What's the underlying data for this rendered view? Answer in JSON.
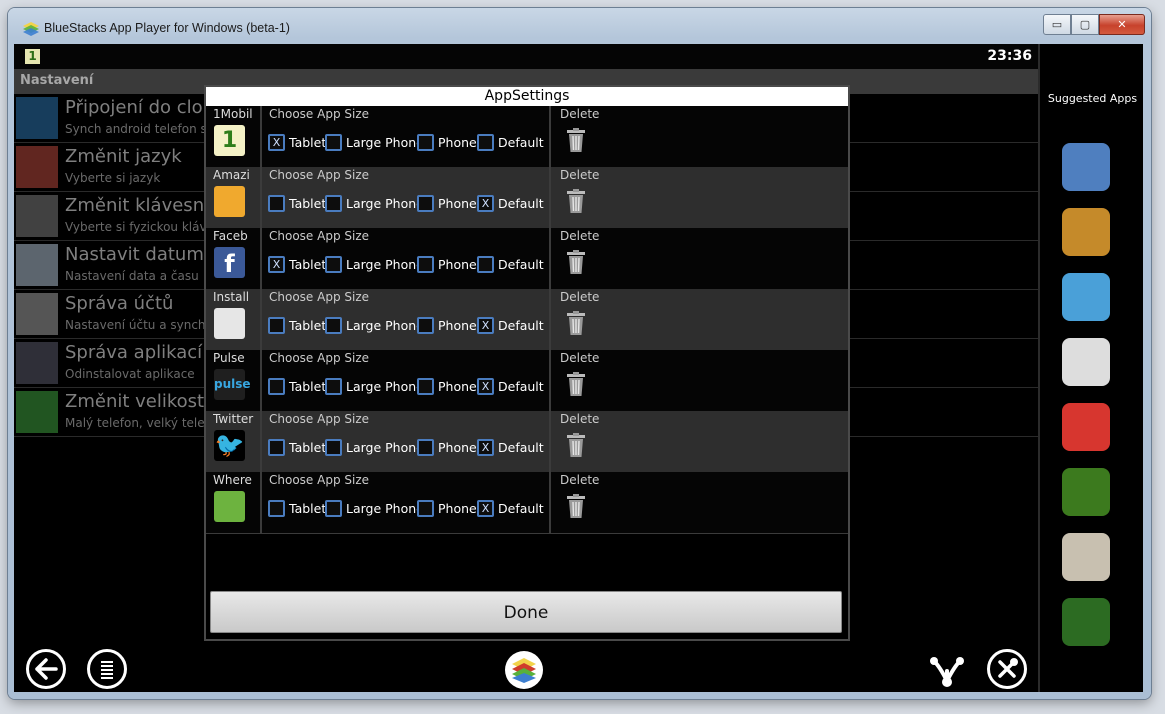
{
  "window": {
    "title": "BlueStacks App Player for Windows (beta-1)",
    "buttons": {
      "minimize": "▭",
      "maximize": "▢",
      "close": "✕"
    }
  },
  "statusbar": {
    "notification_icon": "1",
    "time": "23:36"
  },
  "settings": {
    "header": "Nastavení",
    "rows": [
      {
        "title": "Připojení do cloudu",
        "subtitle": "Synch android telefon s PC",
        "icon": "cloud-phone-icon"
      },
      {
        "title": "Změnit jazyk",
        "subtitle": "Vyberte si jazyk",
        "icon": "flags-icon"
      },
      {
        "title": "Změnit klávesnici",
        "subtitle": "Vyberte si fyzickou klávesnici",
        "icon": "keyboard-icon"
      },
      {
        "title": "Nastavit datum a čas",
        "subtitle": "Nastavení data a času",
        "icon": "calendar-icon"
      },
      {
        "title": "Správa účtů",
        "subtitle": "Nastavení účtu a synchronizace",
        "icon": "person-icon"
      },
      {
        "title": "Správa aplikací",
        "subtitle": "Odinstalovat aplikace",
        "icon": "trash-bin-icon"
      },
      {
        "title": "Změnit velikost aplikací",
        "subtitle": "Malý telefon, velký telefon, tablet",
        "icon": "resize-arrow-icon"
      }
    ]
  },
  "dialog": {
    "title": "AppSettings",
    "size_label": "Choose App Size",
    "delete_label": "Delete",
    "options": [
      "Tablet",
      "Large Phone",
      "Phone",
      "Default"
    ],
    "done_label": "Done",
    "apps": [
      {
        "name": "1Mobil",
        "selected": "Tablet",
        "icon": "1mobile-icon"
      },
      {
        "name": "Amazi",
        "selected": "Default",
        "icon": "amazing-alex-icon"
      },
      {
        "name": "Faceb",
        "selected": "Tablet",
        "icon": "facebook-icon"
      },
      {
        "name": "Install",
        "selected": "Default",
        "icon": "android-install-icon"
      },
      {
        "name": "Pulse",
        "selected": "Default",
        "icon": "pulse-icon"
      },
      {
        "name": "Twitter",
        "selected": "Default",
        "icon": "twitter-icon"
      },
      {
        "name": "Where",
        "selected": "Default",
        "icon": "wheres-my-water-icon"
      }
    ],
    "check_mark": "X"
  },
  "sidebar": {
    "title": "Suggested Apps",
    "apps": [
      "bucket-app-icon",
      "temple-coin-icon",
      "angry-birds-icon",
      "spiral-icon",
      "angry-birds-rio-icon",
      "bird-cage-icon",
      "red-house-icon",
      "free-game-icon"
    ]
  },
  "navbar": {
    "back": "back-arrow-icon",
    "menu": "menu-icon",
    "home": "bluestacks-logo-icon",
    "share": "share-icon",
    "settings": "tools-icon"
  }
}
